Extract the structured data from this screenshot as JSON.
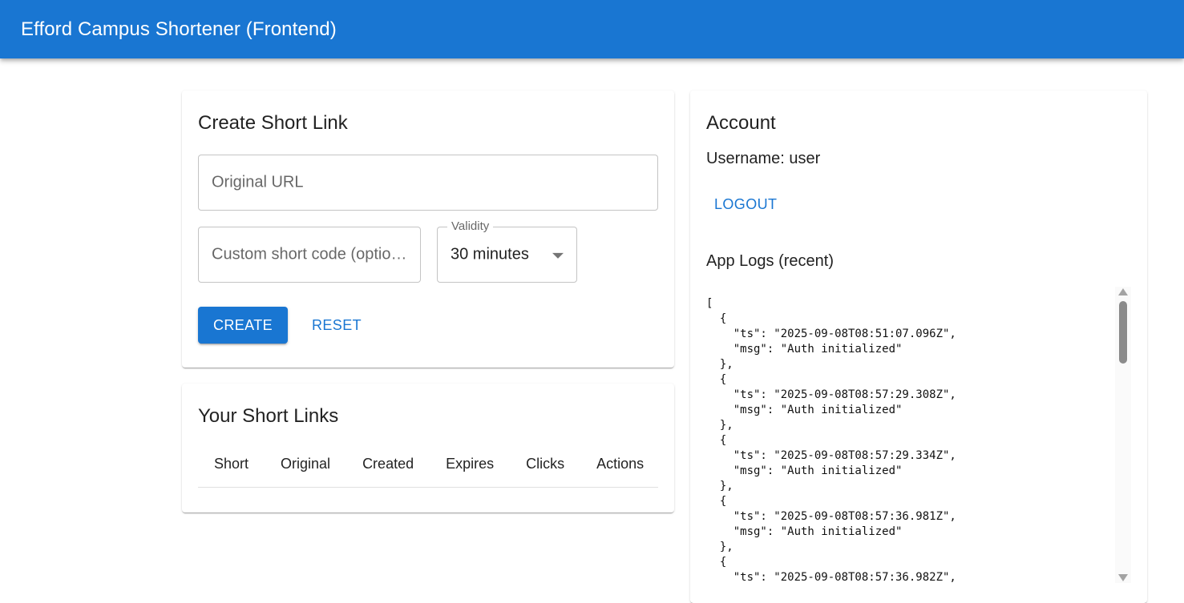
{
  "appbar": {
    "title": "Efford Campus Shortener (Frontend)"
  },
  "create": {
    "title": "Create Short Link",
    "url_placeholder": "Original URL",
    "code_placeholder": "Custom short code (optional)",
    "validity_label": "Validity",
    "validity_value": "30 minutes",
    "create_label": "CREATE",
    "reset_label": "RESET"
  },
  "links": {
    "title": "Your Short Links",
    "columns": [
      "Short",
      "Original",
      "Created",
      "Expires",
      "Clicks",
      "Actions"
    ],
    "rows": []
  },
  "account": {
    "title": "Account",
    "username_text": "Username: user",
    "logout_label": "LOGOUT",
    "logs_title": "App Logs (recent)",
    "logs_text": "[\n  {\n    \"ts\": \"2025-09-08T08:51:07.096Z\",\n    \"msg\": \"Auth initialized\"\n  },\n  {\n    \"ts\": \"2025-09-08T08:57:29.308Z\",\n    \"msg\": \"Auth initialized\"\n  },\n  {\n    \"ts\": \"2025-09-08T08:57:29.334Z\",\n    \"msg\": \"Auth initialized\"\n  },\n  {\n    \"ts\": \"2025-09-08T08:57:36.981Z\",\n    \"msg\": \"Auth initialized\"\n  },\n  {\n    \"ts\": \"2025-09-08T08:57:36.982Z\","
  },
  "colors": {
    "primary": "#1976d2",
    "background": "#ffffff"
  },
  "icons": {
    "dropdown": "arrow-drop-down-icon"
  }
}
